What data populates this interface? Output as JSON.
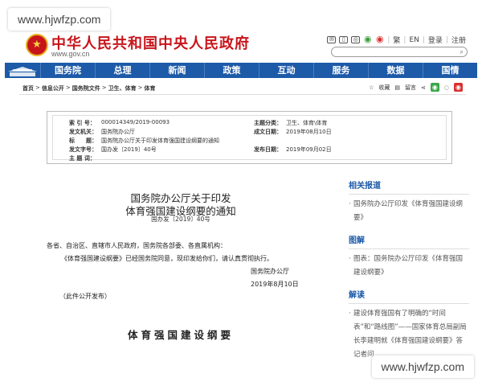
{
  "watermark": "www.hjwfzp.com",
  "site": {
    "title": "中华人民共和国中央人民政府",
    "url": "www.gov.cn"
  },
  "tools": {
    "fan": "繁",
    "en": "EN",
    "login": "登录",
    "register": "注册"
  },
  "nav": [
    "国务院",
    "总理",
    "新闻",
    "政策",
    "互动",
    "服务",
    "数据",
    "国情"
  ],
  "breadcrumb": [
    "首页",
    "信息公开",
    "国务院文件",
    "卫生、体育",
    "体育"
  ],
  "crumb_tools": {
    "favorite": "收藏",
    "print": "留言"
  },
  "meta": {
    "index_key": "索 引 号：",
    "index_val": "000014349/2019-00093",
    "issuer_key": "发文机关：",
    "issuer_val": "国务院办公厅",
    "title_key": "标　　题：",
    "title_val": "国务院办公厅关于印发体育强国建设纲要的通知",
    "docno_key": "发文字号：",
    "docno_val": "国办发〔2019〕40号",
    "topic_key": "主 题 词：",
    "topic_val": "",
    "category_key": "主题分类：",
    "category_val": "卫生、体育\\体育",
    "date_key": "成文日期：",
    "date_val": "2019年08月10日",
    "pub_key": "发布日期：",
    "pub_val": "2019年09月02日"
  },
  "doc": {
    "title_line1": "国务院办公厅关于印发",
    "title_line2": "体育强国建设纲要的通知",
    "number": "国办发〔2019〕40号",
    "recipients": "各省、自治区、直辖市人民政府，国务院各部委、各直属机构：",
    "body": "《体育强国建设纲要》已经国务院同意，现印发给你们，请认真贯彻执行。",
    "signature": "国务院办公厅",
    "date": "2019年8月10日",
    "note": "（此件公开发布）",
    "outline_title": "体育强国建设纲要"
  },
  "sidebar": {
    "related_head": "相关报道",
    "related_item": "国务院办公厅印发《体育强国建设纲要》",
    "graphic_head": "图解",
    "graphic_item": "图表：国务院办公厅印发《体育强国建设纲要》",
    "explain_head": "解读",
    "explain_item": "建设体育强国有了明确的“时间表”和“路线图”——国家体育总局副局长李建明就《体育强国建设纲要》答记者问"
  }
}
